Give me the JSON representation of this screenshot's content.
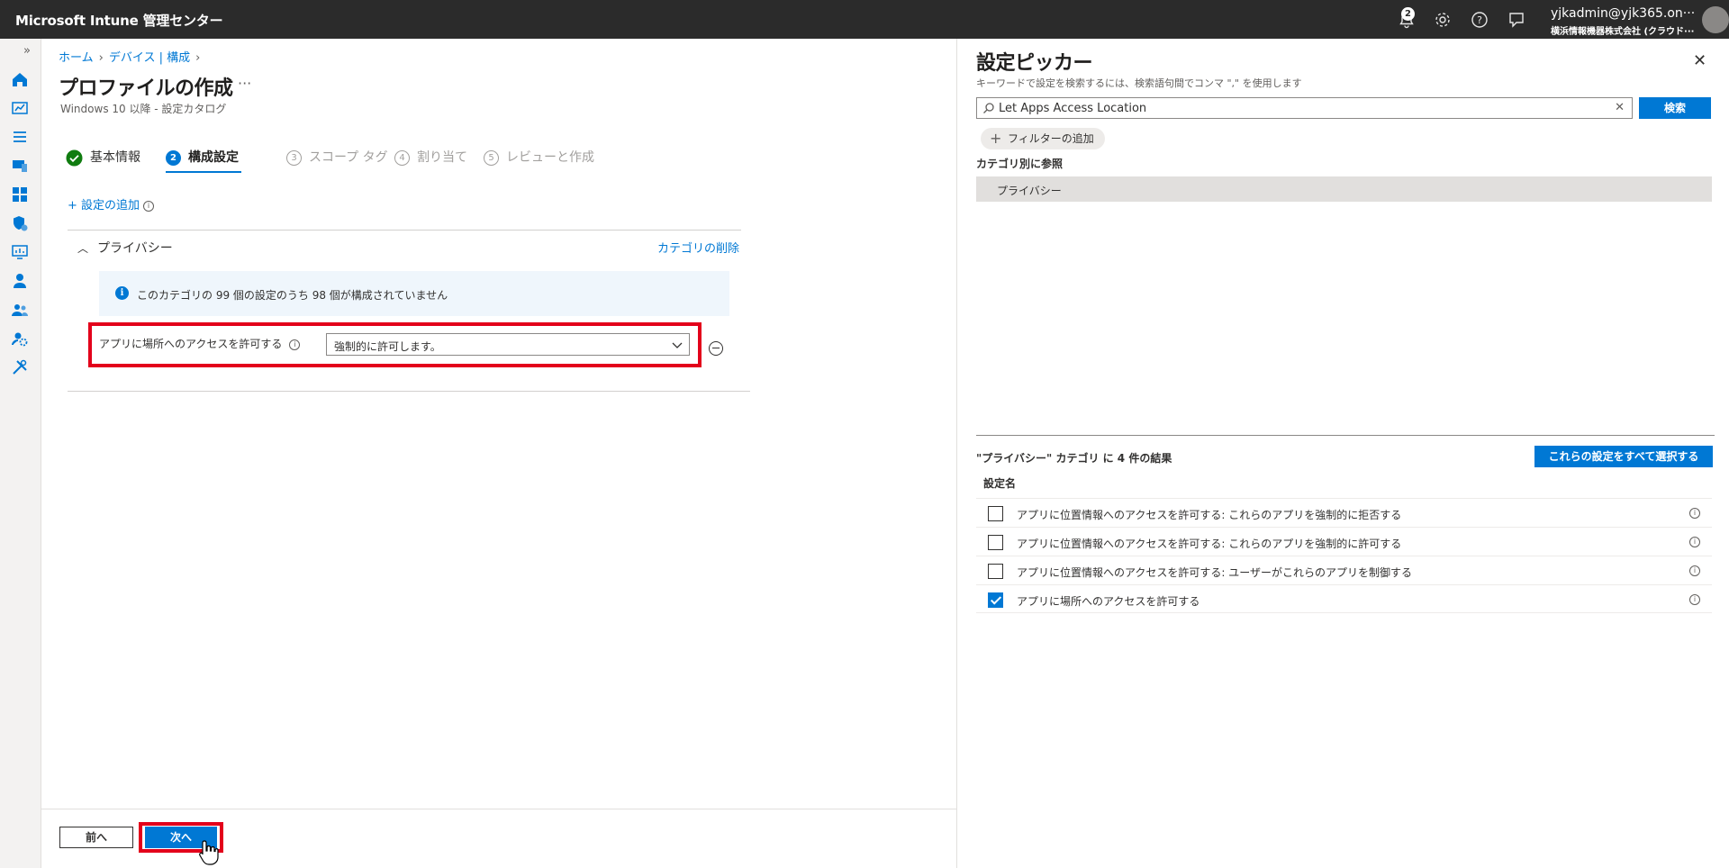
{
  "app": {
    "title": "Microsoft Intune 管理センター",
    "notification_count": "2",
    "user": "yjkadmin@yjk365.on···",
    "tenant": "横浜情報機器株式会社 (クラウド···"
  },
  "breadcrumb": [
    "ホーム",
    "デバイス | 構成"
  ],
  "page": {
    "title": "プロファイルの作成",
    "more": "···",
    "subtitle": "Windows 10 以降 - 設定カタログ"
  },
  "steps": [
    {
      "num": "",
      "label": "基本情報",
      "state": "done"
    },
    {
      "num": "2",
      "label": "構成設定",
      "state": "current"
    },
    {
      "num": "3",
      "label": "スコープ タグ",
      "state": "future"
    },
    {
      "num": "4",
      "label": "割り当て",
      "state": "future"
    },
    {
      "num": "5",
      "label": "レビューと作成",
      "state": "future"
    }
  ],
  "config": {
    "add_setting": "+ 設定の追加",
    "category": "プライバシー",
    "remove_category": "カテゴリの削除",
    "info_text": "このカテゴリの 99 個の設定のうち 98 個が構成されていません",
    "setting_label": "アプリに場所へのアクセスを許可する",
    "setting_value": "強制的に許可します。"
  },
  "footer": {
    "prev": "前へ",
    "next": "次へ"
  },
  "picker": {
    "title": "設定ピッカー",
    "hint": "キーワードで設定を検索するには、検索語句間でコンマ \",\" を使用します",
    "search_value": "Let Apps Access Location",
    "search_button": "検索",
    "add_filter": "フィルターの追加",
    "browse_heading": "カテゴリ別に参照",
    "category_item": "プライバシー",
    "results_text": "\"プライバシー\" カテゴリ に 4 件の結果",
    "select_all": "これらの設定をすべて選択する",
    "column_header": "設定名",
    "results": [
      {
        "label": "アプリに位置情報へのアクセスを許可する: これらのアプリを強制的に拒否する",
        "checked": false
      },
      {
        "label": "アプリに位置情報へのアクセスを許可する: これらのアプリを強制的に許可する",
        "checked": false
      },
      {
        "label": "アプリに位置情報へのアクセスを許可する: ユーザーがこれらのアプリを制御する",
        "checked": false
      },
      {
        "label": "アプリに場所へのアクセスを許可する",
        "checked": true
      }
    ]
  },
  "colors": {
    "accent": "#0078d4",
    "success": "#107c10",
    "highlight": "#e3001b",
    "topbar": "#2b2b2b"
  },
  "icons": {
    "topbar": [
      "bell-icon",
      "gear-icon",
      "help-icon",
      "feedback-icon"
    ],
    "nav": [
      "home-icon",
      "dashboard-icon",
      "all-services-icon",
      "devices-icon",
      "apps-icon",
      "endpoint-security-icon",
      "reports-icon",
      "users-icon",
      "groups-icon",
      "tenant-admin-icon",
      "troubleshooting-icon"
    ]
  }
}
